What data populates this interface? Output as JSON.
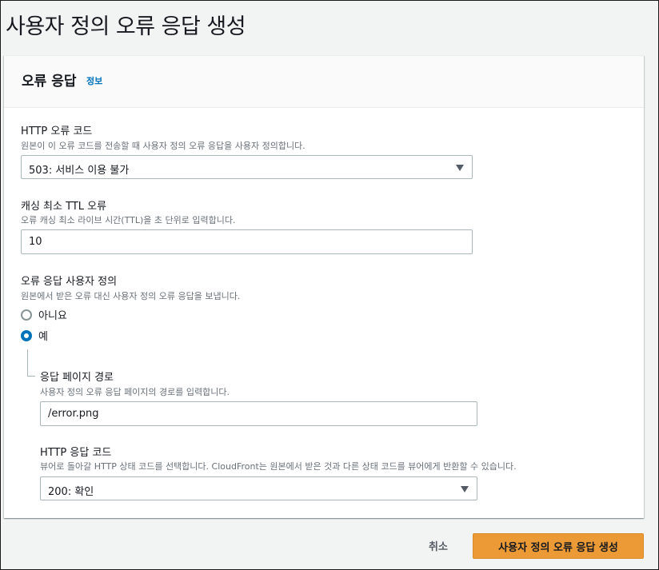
{
  "page": {
    "title": "사용자 정의 오류 응답 생성"
  },
  "panel": {
    "title": "오류 응답",
    "info_link": "정보"
  },
  "http_error_code": {
    "label": "HTTP 오류 코드",
    "description": "원본이 이 오류 코드를 전송할 때 사용자 정의 오류 응답을 사용자 정의합니다.",
    "selected": "503: 서비스 이용 불가"
  },
  "min_ttl": {
    "label": "캐싱 최소 TTL 오류",
    "description": "오류 캐싱 최소 라이브 시간(TTL)을 초 단위로 입력합니다.",
    "value": "10"
  },
  "custom_response": {
    "label": "오류 응답 사용자 정의",
    "description": "원본에서 받은 오류 대신 사용자 정의 오류 응답을 보냅니다.",
    "options": [
      {
        "label": "아니요",
        "checked": false
      },
      {
        "label": "예",
        "checked": true
      }
    ]
  },
  "response_page_path": {
    "label": "응답 페이지 경로",
    "description": "사용자 정의 오류 응답 페이지의 경로를 입력합니다.",
    "value": "/error.png"
  },
  "http_response_code": {
    "label": "HTTP 응답 코드",
    "description": "뷰어로 돌아갈 HTTP 상태 코드를 선택합니다. CloudFront는 원본에서 받은 것과 다른 상태 코드를 뷰어에게 반환할 수 있습니다.",
    "selected": "200: 확인"
  },
  "actions": {
    "cancel": "취소",
    "create": "사용자 정의 오류 응답 생성"
  },
  "colors": {
    "accent": "#0073bb",
    "primary_button": "#ec9a36",
    "background": "#f2f3f3"
  }
}
